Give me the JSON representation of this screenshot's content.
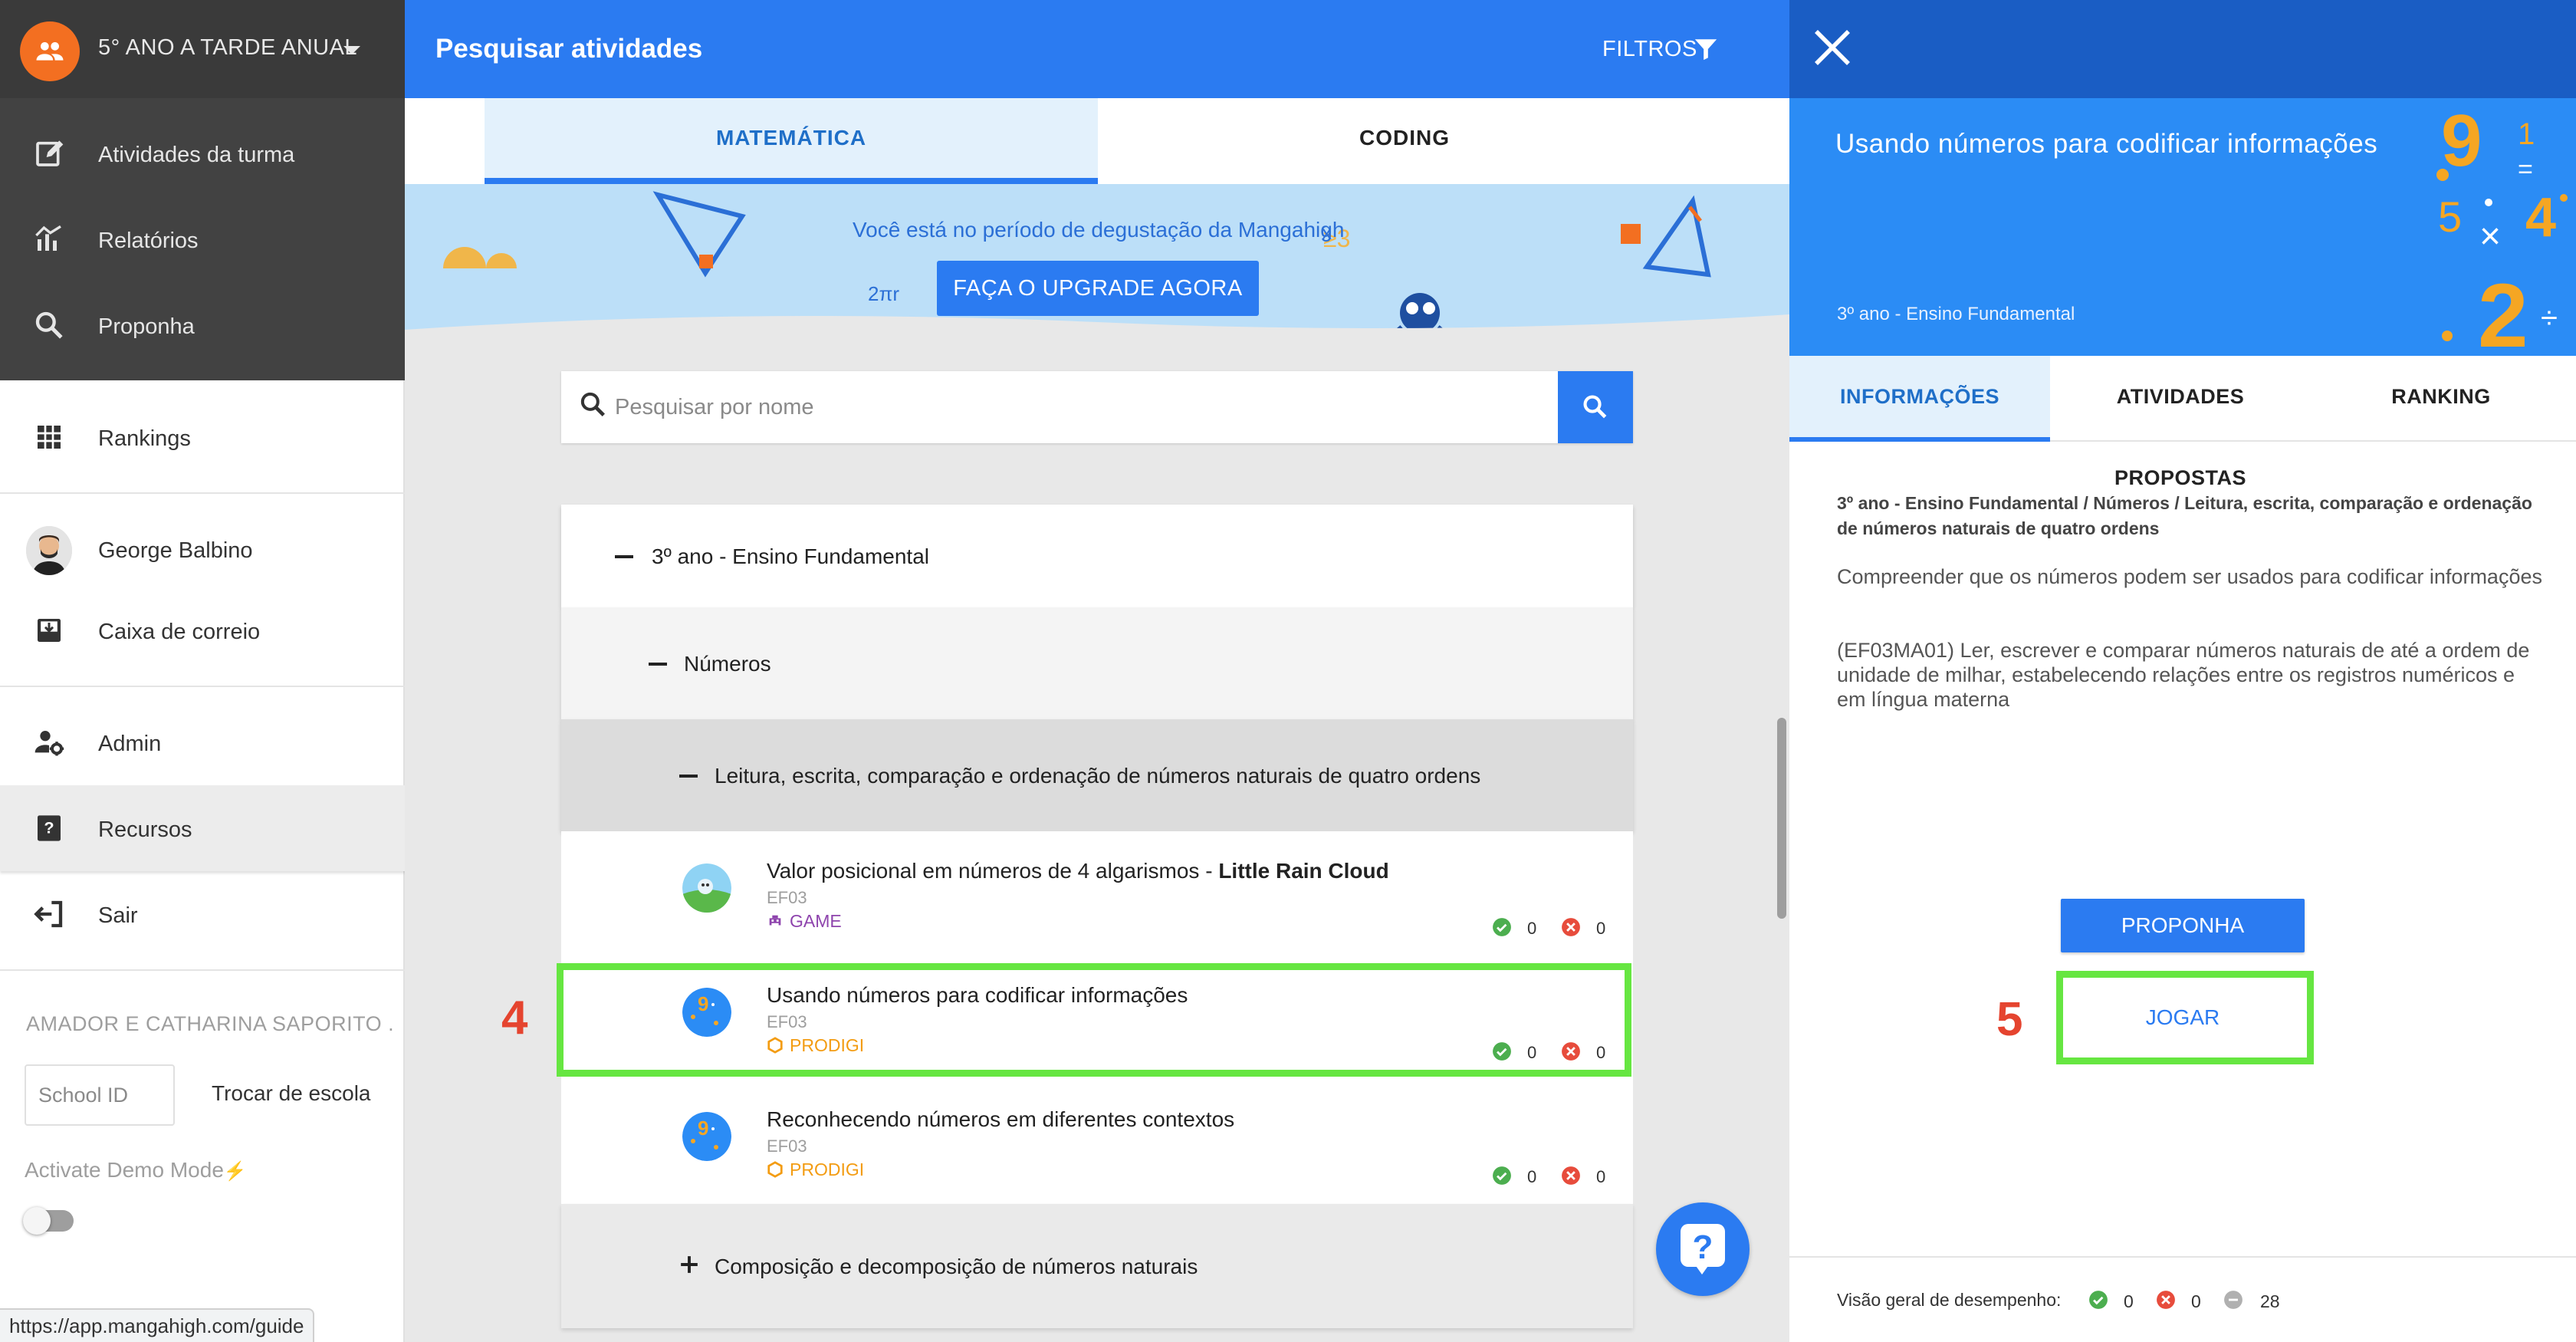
{
  "sidebar": {
    "class_name": "5° ANO A TARDE ANUAL",
    "nav": {
      "class_activities": "Atividades da turma",
      "reports": "Relatórios",
      "propose": "Proponha",
      "rankings": "Rankings",
      "user": "George Balbino",
      "mailbox": "Caixa de correio",
      "admin": "Admin",
      "resources": "Recursos",
      "logout": "Sair"
    },
    "school_name": "AMADOR E CATHARINA SAPORITO ...",
    "school_id_placeholder": "School ID",
    "switch_school": "Trocar de escola",
    "demo_mode": "Activate Demo Mode",
    "demo_mode_on": false
  },
  "status_url": "https://app.mangahigh.com/guide",
  "search": {
    "title": "Pesquisar atividades",
    "filters": "FILTROS",
    "tabs": [
      "MATEMÁTICA",
      "CODING"
    ],
    "active_tab": "MATEMÁTICA",
    "placeholder": "Pesquisar por nome"
  },
  "banner": {
    "text": "Você está no período de degustação da Mangahigh",
    "upgrade_button": "FAÇA O UPGRADE AGORA",
    "decor_formula": "2πr"
  },
  "tree": {
    "grade": "3º ano - Ensino Fundamental",
    "topic": "Números",
    "subtopic": "Leitura, escrita, comparação e ordenação de números naturais de quatro ordens",
    "activities": [
      {
        "title": "Valor posicional em números de 4 algarismos - ",
        "title_bold": "Little Rain Cloud",
        "code": "EF03",
        "type": "GAME",
        "correct": "0",
        "wrong": "0"
      },
      {
        "title": "Usando números para codificar informações",
        "title_bold": "",
        "code": "EF03",
        "type": "PRODIGI",
        "correct": "0",
        "wrong": "0"
      },
      {
        "title": "Reconhecendo números em diferentes contextos",
        "title_bold": "",
        "code": "EF03",
        "type": "PRODIGI",
        "correct": "0",
        "wrong": "0"
      }
    ],
    "next_subtopic": "Composição e decomposição de números naturais"
  },
  "annotations": {
    "step4": "4",
    "step5": "5",
    "highlight_color": "#66e641",
    "step_color": "#e5442f"
  },
  "panel": {
    "title": "Usando números para codificar informações",
    "grade": "3º ano - Ensino Fundamental",
    "tabs": [
      "INFORMAÇÕES",
      "ATIVIDADES PROPOSTAS",
      "RANKING"
    ],
    "active_tab": "INFORMAÇÕES",
    "breadcrumb": "3º ano - Ensino Fundamental  /  Números  /  Leitura, escrita, comparação e ordenação de números naturais de quatro ordens",
    "description": "Compreender que os números podem ser usados para codificar informações",
    "standard": "(EF03MA01) Ler, escrever e comparar números naturais de até a ordem de unidade de milhar, estabelecendo relações entre os registros numéricos e em língua materna",
    "propose_button": "PROPONHA",
    "play_button": "JOGAR",
    "performance_label": "Visão geral de desempenho:",
    "performance": {
      "correct": "0",
      "wrong": "0",
      "pending": "28"
    }
  },
  "colors": {
    "primary": "#2b7bf1",
    "sidebar_dark": "#424242",
    "accent_orange": "#f36f21",
    "game": "#8e44ad",
    "prodigi": "#f39c12"
  }
}
